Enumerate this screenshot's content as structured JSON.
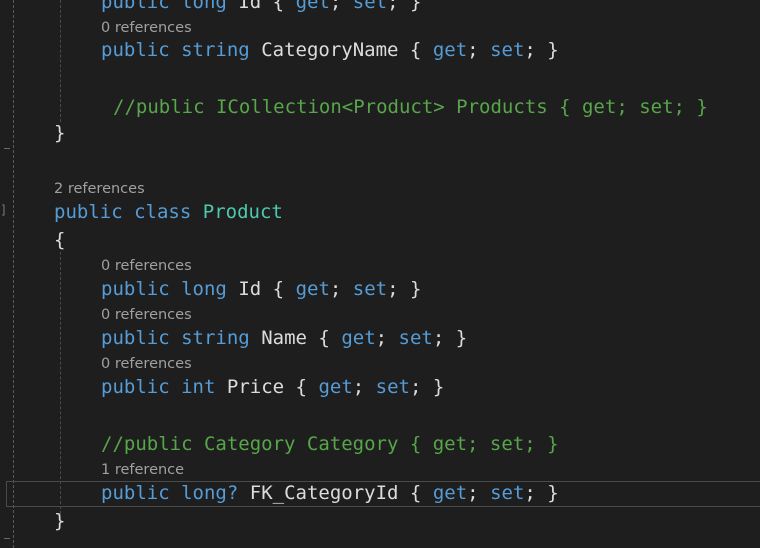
{
  "editor": {
    "lines": {
      "l0": [
        "public",
        "long",
        "Id",
        "{",
        "get",
        ";",
        "set",
        ";",
        "}"
      ],
      "lens0": "0 references",
      "l1": [
        "public",
        "string",
        "CategoryName",
        "{",
        "get",
        ";",
        "set",
        ";",
        "}"
      ],
      "l2": "//public ICollection<Product> Products { get; set; }",
      "l3": "}",
      "lens_class": "2 references",
      "l4": [
        "public",
        "class",
        "Product"
      ],
      "l5": "{",
      "lens1": "0 references",
      "l6": [
        "public",
        "long",
        "Id",
        "{",
        "get",
        ";",
        "set",
        ";",
        "}"
      ],
      "lens2": "0 references",
      "l7": [
        "public",
        "string",
        "Name",
        "{",
        "get",
        ";",
        "set",
        ";",
        "}"
      ],
      "lens3": "0 references",
      "l8": [
        "public",
        "int",
        "Price",
        "{",
        "get",
        ";",
        "set",
        ";",
        "}"
      ],
      "l9": "//public Category Category { get; set; }",
      "lens4": "1 reference",
      "l10": [
        "public",
        "long?",
        "FK_CategoryId",
        "{",
        "get",
        ";",
        "set",
        ";",
        "}"
      ],
      "l11": "}"
    }
  }
}
